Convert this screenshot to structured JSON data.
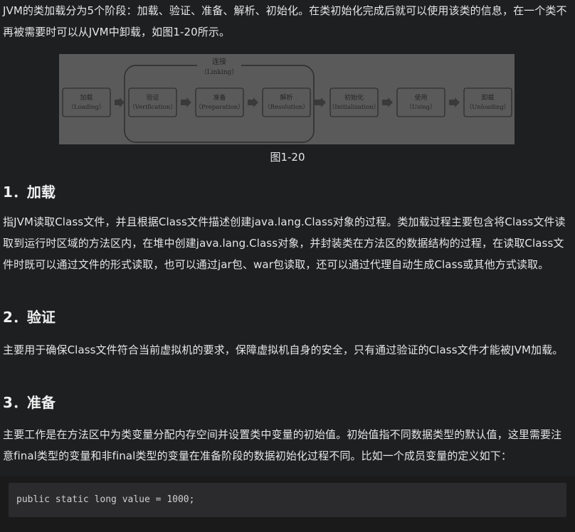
{
  "intro": "JVM的类加载分为5个阶段：加载、验证、准备、解析、初始化。在类初始化完成后就可以使用该类的信息，在一个类不再被需要时可以从JVM中卸载，如图1-20所示。",
  "figure": {
    "group_label": "连接",
    "group_label_en": "（Linking）",
    "stages": [
      {
        "zh": "加载",
        "en": "（Loading）"
      },
      {
        "zh": "验证",
        "en": "（Verification）"
      },
      {
        "zh": "准备",
        "en": "（Preparation）"
      },
      {
        "zh": "解析",
        "en": "（Resolution）"
      },
      {
        "zh": "初始化",
        "en": "（Initialization）"
      },
      {
        "zh": "使用",
        "en": "（Using）"
      },
      {
        "zh": "卸载",
        "en": "（Unloading）"
      }
    ],
    "caption": "图1-20"
  },
  "sections": [
    {
      "heading": "1．加载",
      "body": "指JVM读取Class文件，并且根据Class文件描述创建java.lang.Class对象的过程。类加载过程主要包含将Class文件读取到运行时区域的方法区内，在堆中创建java.lang.Class对象，并封装类在方法区的数据结构的过程，在读取Class文件时既可以通过文件的形式读取，也可以通过jar包、war包读取，还可以通过代理自动生成Class或其他方式读取。"
    },
    {
      "heading": "2．验证",
      "body": "主要用于确保Class文件符合当前虚拟机的要求，保障虚拟机自身的安全，只有通过验证的Class文件才能被JVM加载。"
    },
    {
      "heading": "3．准备",
      "body": "主要工作是在方法区中为类变量分配内存空间并设置类中变量的初始值。初始值指不同数据类型的默认值，这里需要注意final类型的变量和非final类型的变量在准备阶段的数据初始化过程不同。比如一个成员变量的定义如下："
    }
  ],
  "code": "public static long value = 1000;",
  "colors": {
    "background": "#1e1f21",
    "figure_bg": "#5a5a5a",
    "figure_ink": "#262626",
    "code_bg": "#2b2b2d"
  }
}
